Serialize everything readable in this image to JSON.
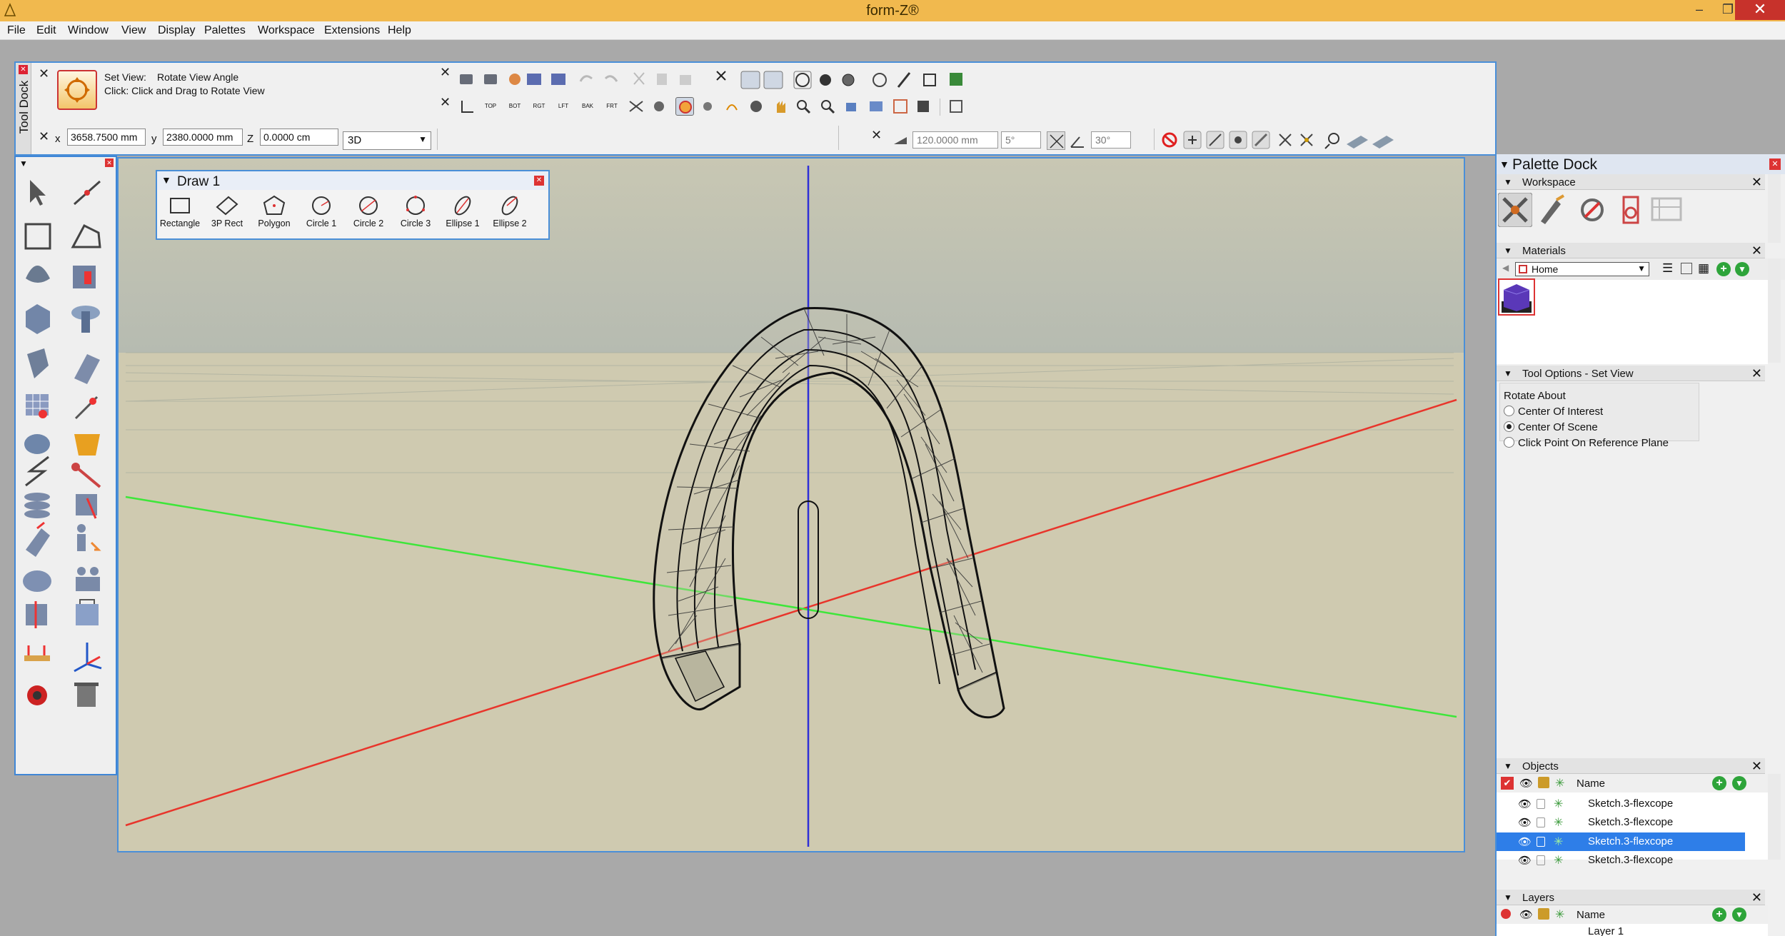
{
  "window": {
    "title": "form-Z®",
    "min_glyph": "–",
    "max_glyph": "❐",
    "close_glyph": "✕"
  },
  "menu": [
    "File",
    "Edit",
    "Window",
    "View",
    "Display",
    "Palettes",
    "Workspace",
    "Extensions",
    "Help"
  ],
  "tool_dock": {
    "label": "Tool Dock",
    "hint_title_prefix": "Set View:",
    "hint_title": "Rotate View Angle",
    "hint_click": "Click: Click and Drag to Rotate View",
    "x_label": "x",
    "x_value": "3658.7500 mm",
    "y_label": "y",
    "y_value": "2380.0000 mm",
    "z_label": "Z",
    "z_value": "0.0000 cm",
    "view_mode": "3D",
    "snap_distance": "120.0000 mm",
    "angle1": "5°",
    "angle2": "30°",
    "view_labels": [
      "TOP",
      "BOT",
      "RGT",
      "LFT",
      "BAK",
      "FRT"
    ]
  },
  "draw_palette": {
    "title": "Draw 1",
    "tools": [
      "Rectangle",
      "3P Rect",
      "Polygon",
      "Circle 1",
      "Circle 2",
      "Circle 3",
      "Ellipse 1",
      "Ellipse 2"
    ]
  },
  "palette_dock": {
    "title": "Palette Dock",
    "workspace_title": "Workspace",
    "materials_title": "Materials",
    "materials_library": "Home",
    "tool_options_title": "Tool Options - Set View",
    "rotate_about_label": "Rotate About",
    "rotate_options": [
      {
        "label": "Center Of Interest",
        "selected": false
      },
      {
        "label": "Center Of Scene",
        "selected": true
      },
      {
        "label": "Click Point On Reference Plane",
        "selected": false
      }
    ],
    "objects_title": "Objects",
    "objects_name_header": "Name",
    "objects": [
      {
        "name": "Sketch.3-flexcope",
        "selected": false
      },
      {
        "name": "Sketch.3-flexcope",
        "selected": false
      },
      {
        "name": "Sketch.3-flexcope",
        "selected": true
      },
      {
        "name": "Sketch.3-flexcope",
        "selected": false
      }
    ],
    "layers_title": "Layers",
    "layers_name_header": "Name",
    "layer_partial": "Layer 1"
  },
  "colors": {
    "title_bar": "#f1b94e",
    "accent": "#4a8fd8",
    "selection": "#2e7ee8",
    "x_axis": "#e8352b",
    "y_axis": "#3ee63a",
    "z_axis": "#2f2fd6",
    "ground": "#d2cdb4",
    "sky": "#b8bdb5"
  },
  "icons": {
    "left_tools": [
      "pointer-icon",
      "line-icon",
      "rectangle-icon",
      "polyline-icon",
      "sphere-icon",
      "extrude-icon",
      "cube-icon",
      "revolve-icon",
      "deform-icon",
      "sweep-icon",
      "grid-icon",
      "magic-icon",
      "blob-icon",
      "cup-icon",
      "path-icon",
      "wrench-icon",
      "spring-icon",
      "cylinder-cut-icon",
      "blend-icon",
      "person-move-icon",
      "cloud-icon",
      "people-icon",
      "split-icon",
      "group-icon",
      "measure-icon",
      "axes-icon",
      "paint-icon",
      "trash-icon"
    ]
  }
}
